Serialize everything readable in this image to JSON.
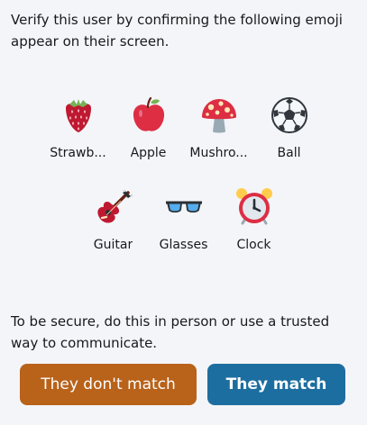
{
  "intro_text": "Verify this user by confirming the following emoji appear on their screen.",
  "emoji_rows": [
    [
      {
        "icon": "strawberry-icon",
        "label": "Strawb..."
      },
      {
        "icon": "apple-icon",
        "label": "Apple"
      },
      {
        "icon": "mushroom-icon",
        "label": "Mushro..."
      },
      {
        "icon": "ball-icon",
        "label": "Ball"
      }
    ],
    [
      {
        "icon": "guitar-icon",
        "label": "Guitar"
      },
      {
        "icon": "glasses-icon",
        "label": "Glasses"
      },
      {
        "icon": "clock-icon",
        "label": "Clock"
      }
    ]
  ],
  "outro_text": "To be secure, do this in person or use a trusted way to communicate.",
  "buttons": {
    "mismatch_label": "They don't match",
    "match_label": "They match"
  },
  "colors": {
    "background": "#f4f5f8",
    "mismatch_button": "#b8621a",
    "match_button": "#1d6ea0"
  }
}
